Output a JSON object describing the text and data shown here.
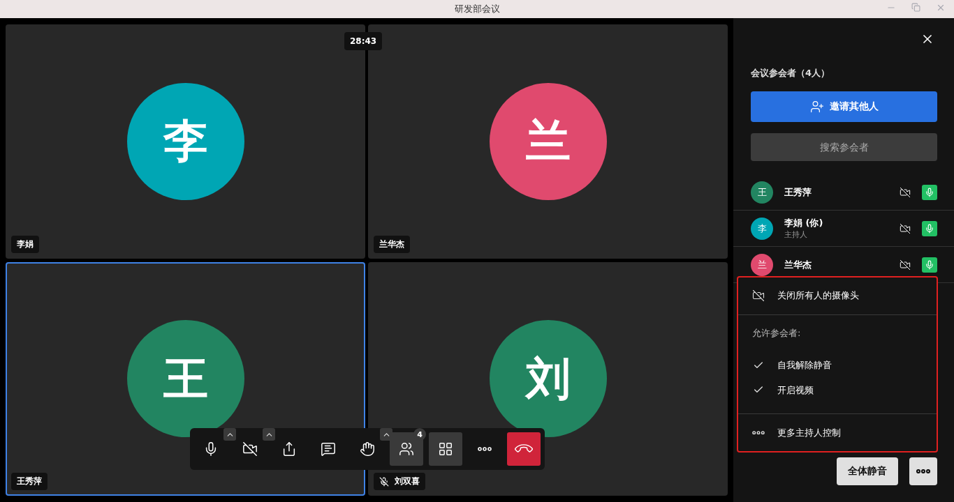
{
  "window": {
    "title": "研发部会议"
  },
  "timer": "28:43",
  "tiles": [
    {
      "initial": "李",
      "name": "李娟",
      "color": "#00a6b4",
      "selected": false,
      "muted": false
    },
    {
      "initial": "兰",
      "name": "兰华杰",
      "color": "#e04a6e",
      "selected": false,
      "muted": false
    },
    {
      "initial": "王",
      "name": "王秀萍",
      "color": "#228561",
      "selected": true,
      "muted": false
    },
    {
      "initial": "刘",
      "name": "刘双喜",
      "color": "#228561",
      "selected": false,
      "muted": true
    }
  ],
  "toolbar": [
    {
      "kind": "mic",
      "caret": true,
      "active": false
    },
    {
      "kind": "camera",
      "caret": true,
      "active": false
    },
    {
      "kind": "share",
      "caret": false,
      "active": false
    },
    {
      "kind": "chat",
      "caret": false,
      "active": false
    },
    {
      "kind": "hand",
      "caret": true,
      "active": false
    },
    {
      "kind": "participants",
      "caret": false,
      "active": true,
      "badge": "4"
    },
    {
      "kind": "grid",
      "caret": false,
      "active": true
    },
    {
      "kind": "more",
      "caret": false,
      "active": false
    },
    {
      "kind": "hangup",
      "caret": false
    }
  ],
  "sidebar": {
    "title": "会议参会者（4人）",
    "invite": "邀请其他人",
    "search": {
      "placeholder": "搜索参会者"
    },
    "participants": [
      {
        "initial": "王",
        "name": "王秀萍",
        "color": "#228561",
        "video_off": true,
        "mic_on": true
      },
      {
        "initial": "李",
        "name": "李娟 (你)",
        "role": "主持人",
        "color": "#00a6b4",
        "video_off": true,
        "mic_on": true
      },
      {
        "initial": "兰",
        "name": "兰华杰",
        "color": "#e04a6e",
        "video_off": true,
        "mic_on": true
      }
    ],
    "menu": [
      {
        "kind": "action",
        "label": "关闭所有人的摄像头"
      },
      {
        "kind": "heading",
        "label": "允许参会者:"
      },
      {
        "kind": "check",
        "label": "自我解除静音",
        "checked": true
      },
      {
        "kind": "check",
        "label": "开启视频",
        "checked": true
      },
      {
        "kind": "more",
        "label": "更多主持人控制"
      }
    ],
    "mute_all": "全体静音"
  }
}
